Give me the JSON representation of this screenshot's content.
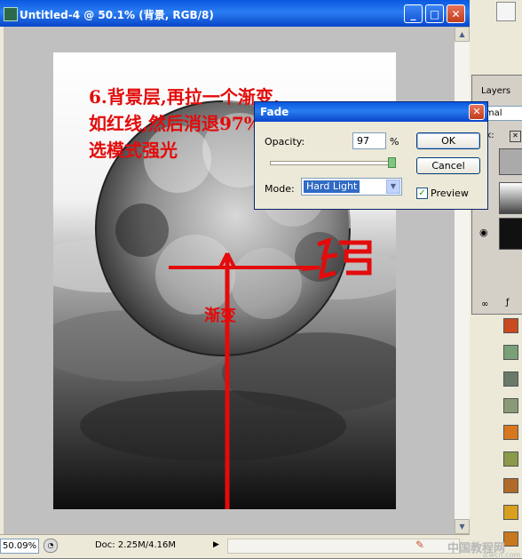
{
  "window": {
    "title": "Untitled-4 @ 50.1% (背景, RGB/8)",
    "minimize_glyph": "_",
    "maximize_glyph": "□",
    "close_glyph": "✕"
  },
  "statusbar": {
    "zoom": "50.09%",
    "doc_info": "Doc: 2.25M/4.16M"
  },
  "annotation": {
    "line1": "6.背景层,再拉一个渐变,",
    "line2": "如红线,然后消退97%",
    "line3": "选模式强光",
    "gradient_label": "渐变"
  },
  "fade_dialog": {
    "title": "Fade",
    "opacity_label": "Opacity:",
    "opacity_value": "97",
    "percent_sign": "%",
    "opacity_fraction": 0.97,
    "mode_label": "Mode:",
    "mode_value": "Hard Light",
    "ok_label": "OK",
    "cancel_label": "Cancel",
    "preview_label": "Preview",
    "preview_checked": true
  },
  "layers_panel": {
    "tab_label": "Layers",
    "blend_mode": "rmal",
    "lock_label": "ck:"
  },
  "watermark": {
    "site": "中国教程网",
    "url": "jcwcn.com"
  },
  "colors": {
    "annotation_red": "#e30b0b",
    "xp_title_blue": "#0a58e0",
    "selection_blue": "#316ac5"
  }
}
